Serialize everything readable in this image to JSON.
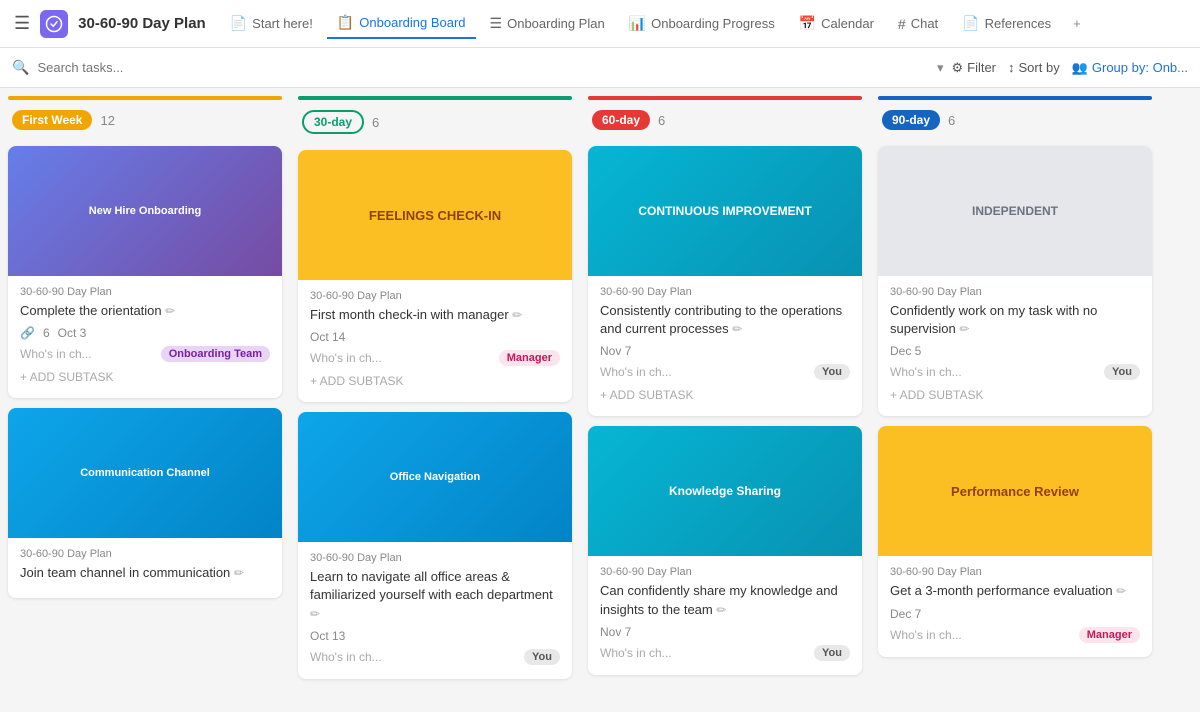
{
  "app": {
    "title": "30-60-90 Day Plan",
    "logo_text": "CU"
  },
  "nav": {
    "hamburger": "☰",
    "tabs": [
      {
        "label": "Start here!",
        "icon": "📄",
        "active": false
      },
      {
        "label": "Onboarding Board",
        "icon": "📋",
        "active": true
      },
      {
        "label": "Onboarding Plan",
        "icon": "☰",
        "active": false
      },
      {
        "label": "Onboarding Progress",
        "icon": "📊",
        "active": false
      },
      {
        "label": "Calendar",
        "icon": "📅",
        "active": false
      },
      {
        "label": "Chat",
        "icon": "#",
        "active": false
      },
      {
        "label": "References",
        "icon": "📄",
        "active": false
      }
    ],
    "plus": "+"
  },
  "toolbar": {
    "search_placeholder": "Search tasks...",
    "filter_label": "Filter",
    "sort_label": "Sort by",
    "group_label": "Group by: Onb..."
  },
  "columns": [
    {
      "id": "first-week",
      "label": "First Week",
      "label_class": "label-first",
      "bar_class": "bar-yellow",
      "count": 12,
      "cards": [
        {
          "img_class": "img-onboarding",
          "img_text": "New Hire Onboarding",
          "source": "30-60-90 Day Plan",
          "title": "Complete the orientation",
          "has_subtasks": true,
          "subtask_count": 6,
          "date": "Oct 3",
          "who_label": "Who's in ch...",
          "badge_label": "Onboarding Team",
          "badge_class": "badge-onboarding",
          "add_subtask": "+ ADD SUBTASK"
        },
        {
          "img_class": "img-comm",
          "img_text": "Communication Channel",
          "source": "30-60-90 Day Plan",
          "title": "Join team channel in communication",
          "has_subtasks": false,
          "date": null,
          "who_label": null,
          "badge_label": null,
          "badge_class": null,
          "add_subtask": null
        }
      ]
    },
    {
      "id": "30-day",
      "label": "30-day",
      "label_class": "label-30",
      "bar_class": "bar-green",
      "count": 6,
      "cards": [
        {
          "img_class": "img-feelings",
          "img_text": "FEELINGS CHECK-IN",
          "source": "30-60-90 Day Plan",
          "title": "First month check-in with manager",
          "has_subtasks": false,
          "date": "Oct 14",
          "who_label": "Who's in ch...",
          "badge_label": "Manager",
          "badge_class": "badge-manager",
          "add_subtask": "+ ADD SUBTASK"
        },
        {
          "img_class": "img-comm",
          "img_text": "Office Navigation",
          "source": "30-60-90 Day Plan",
          "title": "Learn to navigate all office areas & familiarized yourself with each department",
          "has_subtasks": false,
          "date": "Oct 13",
          "who_label": "Who's in ch...",
          "badge_label": "You",
          "badge_class": "badge-you",
          "add_subtask": null
        }
      ]
    },
    {
      "id": "60-day",
      "label": "60-day",
      "label_class": "label-60",
      "bar_class": "bar-red",
      "count": 6,
      "cards": [
        {
          "img_class": "img-continuous",
          "img_text": "CONTINUOUS IMPROVEMENT",
          "source": "30-60-90 Day Plan",
          "title": "Consistently contributing to the operations and current processes",
          "has_subtasks": false,
          "date": "Nov 7",
          "who_label": "Who's in ch...",
          "badge_label": "You",
          "badge_class": "badge-you",
          "add_subtask": "+ ADD SUBTASK"
        },
        {
          "img_class": "img-continuous",
          "img_text": "Knowledge Sharing",
          "source": "30-60-90 Day Plan",
          "title": "Can confidently share my knowledge and insights to the team",
          "has_subtasks": false,
          "date": "Nov 7",
          "who_label": "Who's in ch...",
          "badge_label": "You",
          "badge_class": "badge-you",
          "add_subtask": null
        }
      ]
    },
    {
      "id": "90-day",
      "label": "90-day",
      "label_class": "label-90",
      "bar_class": "bar-blue",
      "count": 6,
      "cards": [
        {
          "img_class": "img-independent",
          "img_text": "INDEPENDENT",
          "source": "30-60-90 Day Plan",
          "title": "Confidently work on my task with no supervision",
          "has_subtasks": false,
          "date": "Dec 5",
          "who_label": "Who's in ch...",
          "badge_label": "You",
          "badge_class": "badge-you",
          "add_subtask": "+ ADD SUBTASK"
        },
        {
          "img_class": "img-feelings",
          "img_text": "Performance Review",
          "source": "30-60-90 Day Plan",
          "title": "Get a 3-month performance evaluation",
          "has_subtasks": false,
          "date": "Dec 7",
          "who_label": "Who's in ch...",
          "badge_label": "Manager",
          "badge_class": "badge-manager",
          "add_subtask": null
        }
      ]
    }
  ]
}
